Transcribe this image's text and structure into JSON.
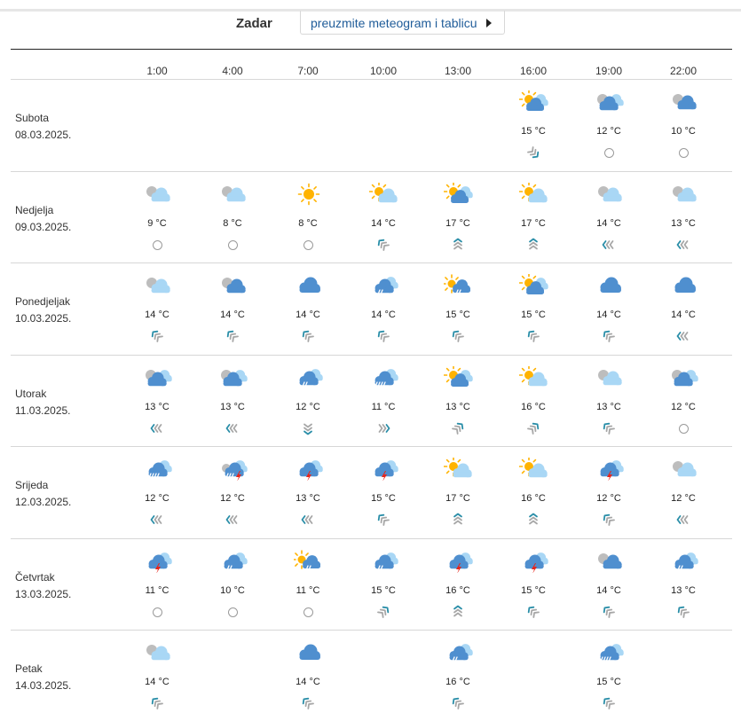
{
  "header": {
    "city": "Zadar",
    "download_label": "preuzmite meteogram i tablicu"
  },
  "hours": [
    "1:00",
    "4:00",
    "7:00",
    "10:00",
    "13:00",
    "16:00",
    "19:00",
    "22:00"
  ],
  "colors": {
    "cloud_dark": "#4f8fcf",
    "cloud_light": "#a9d7f5",
    "sun": "#ffb300",
    "lightning": "#e8251b",
    "wind_teal": "#2a8ea8",
    "wind_grey": "#a7a7a7"
  },
  "days": [
    {
      "name": "Subota",
      "date": "08.03.2025.",
      "cells": [
        null,
        null,
        null,
        null,
        null,
        {
          "icon": "sun-cloud-icon",
          "temp": "15 °C",
          "wind": "wind-se-icon"
        },
        {
          "icon": "partly-cloudy-dark-icon",
          "temp": "12 °C",
          "wind": "calm-icon"
        },
        {
          "icon": "cloud-partial-icon",
          "temp": "10 °C",
          "wind": "calm-icon"
        }
      ]
    },
    {
      "name": "Nedjelja",
      "date": "09.03.2025.",
      "cells": [
        {
          "icon": "cloud-light-icon",
          "temp": "9 °C",
          "wind": "calm-icon"
        },
        {
          "icon": "cloud-light-icon",
          "temp": "8 °C",
          "wind": "calm-icon"
        },
        {
          "icon": "sun-icon",
          "temp": "8 °C",
          "wind": "calm-icon"
        },
        {
          "icon": "sun-light-cloud-icon",
          "temp": "14 °C",
          "wind": "wind-nw-icon"
        },
        {
          "icon": "sun-cloud-icon",
          "temp": "17 °C",
          "wind": "wind-n-icon"
        },
        {
          "icon": "sun-light-cloud-icon",
          "temp": "17 °C",
          "wind": "wind-n-icon"
        },
        {
          "icon": "cloud-light-icon",
          "temp": "14 °C",
          "wind": "wind-w-icon"
        },
        {
          "icon": "cloud-light-icon",
          "temp": "13 °C",
          "wind": "wind-w-icon"
        }
      ]
    },
    {
      "name": "Ponedjeljak",
      "date": "10.03.2025.",
      "cells": [
        {
          "icon": "cloud-light-icon",
          "temp": "14 °C",
          "wind": "wind-nw-icon"
        },
        {
          "icon": "cloud-partial-icon",
          "temp": "14 °C",
          "wind": "wind-nw-icon"
        },
        {
          "icon": "cloud-icon",
          "temp": "14 °C",
          "wind": "wind-nw-icon"
        },
        {
          "icon": "cloud-rain-icon",
          "temp": "14 °C",
          "wind": "wind-nw-icon"
        },
        {
          "icon": "sun-rain-icon",
          "temp": "15 °C",
          "wind": "wind-nw-icon"
        },
        {
          "icon": "sun-cloud-icon",
          "temp": "15 °C",
          "wind": "wind-nw-icon"
        },
        {
          "icon": "cloud-icon",
          "temp": "14 °C",
          "wind": "wind-nw-icon"
        },
        {
          "icon": "cloud-icon",
          "temp": "14 °C",
          "wind": "wind-w-icon"
        }
      ]
    },
    {
      "name": "Utorak",
      "date": "11.03.2025.",
      "cells": [
        {
          "icon": "partly-cloudy-dark-icon",
          "temp": "13 °C",
          "wind": "wind-w-icon"
        },
        {
          "icon": "partly-cloudy-dark-icon",
          "temp": "13 °C",
          "wind": "wind-w-icon"
        },
        {
          "icon": "cloud-rain-icon",
          "temp": "12 °C",
          "wind": "wind-s-icon"
        },
        {
          "icon": "cloud-heavy-rain-icon",
          "temp": "11 °C",
          "wind": "wind-e-icon"
        },
        {
          "icon": "sun-cloud-icon",
          "temp": "13 °C",
          "wind": "wind-ne-icon"
        },
        {
          "icon": "sun-light-cloud-icon",
          "temp": "16 °C",
          "wind": "wind-ne-icon"
        },
        {
          "icon": "cloud-light-icon",
          "temp": "13 °C",
          "wind": "wind-nw-icon"
        },
        {
          "icon": "partly-cloudy-dark-icon",
          "temp": "12 °C",
          "wind": "calm-icon"
        }
      ]
    },
    {
      "name": "Srijeda",
      "date": "12.03.2025.",
      "cells": [
        {
          "icon": "cloud-heavy-rain-icon",
          "temp": "12 °C",
          "wind": "wind-w-icon"
        },
        {
          "icon": "cloud-storm-rain-icon",
          "temp": "12 °C",
          "wind": "wind-w-icon"
        },
        {
          "icon": "cloud-storm-icon",
          "temp": "13 °C",
          "wind": "wind-w-icon"
        },
        {
          "icon": "cloud-storm-icon",
          "temp": "15 °C",
          "wind": "wind-nw-icon"
        },
        {
          "icon": "sun-light-cloud-icon",
          "temp": "17 °C",
          "wind": "wind-n-icon"
        },
        {
          "icon": "sun-light-cloud-icon",
          "temp": "16 °C",
          "wind": "wind-n-icon"
        },
        {
          "icon": "cloud-storm-icon",
          "temp": "12 °C",
          "wind": "wind-nw-icon"
        },
        {
          "icon": "cloud-light-icon",
          "temp": "12 °C",
          "wind": "wind-w-icon"
        }
      ]
    },
    {
      "name": "Četvrtak",
      "date": "13.03.2025.",
      "cells": [
        {
          "icon": "cloud-storm-icon",
          "temp": "11 °C",
          "wind": "calm-icon"
        },
        {
          "icon": "cloud-rain-icon",
          "temp": "10 °C",
          "wind": "calm-icon"
        },
        {
          "icon": "sun-rain-icon",
          "temp": "11 °C",
          "wind": "calm-icon"
        },
        {
          "icon": "cloud-rain-icon",
          "temp": "15 °C",
          "wind": "wind-ne-icon"
        },
        {
          "icon": "cloud-storm-icon",
          "temp": "16 °C",
          "wind": "wind-n-icon"
        },
        {
          "icon": "cloud-storm-icon",
          "temp": "15 °C",
          "wind": "wind-nw-icon"
        },
        {
          "icon": "cloud-partial-icon",
          "temp": "14 °C",
          "wind": "wind-nw-icon"
        },
        {
          "icon": "cloud-rain-icon",
          "temp": "13 °C",
          "wind": "wind-nw-icon"
        }
      ]
    },
    {
      "name": "Petak",
      "date": "14.03.2025.",
      "cells": [
        {
          "icon": "cloud-light-icon",
          "temp": "14 °C",
          "wind": "wind-nw-icon"
        },
        null,
        {
          "icon": "cloud-icon",
          "temp": "14 °C",
          "wind": "wind-nw-icon"
        },
        null,
        {
          "icon": "cloud-rain-icon",
          "temp": "16 °C",
          "wind": "wind-nw-icon"
        },
        null,
        {
          "icon": "cloud-heavy-rain-icon",
          "temp": "15 °C",
          "wind": "wind-nw-icon"
        },
        null
      ]
    }
  ]
}
